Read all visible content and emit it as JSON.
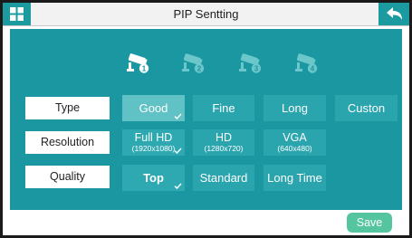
{
  "header": {
    "title": "PIP Sentting",
    "menu_icon": "grid-icon",
    "back_icon": "back-arrow-icon"
  },
  "cameras": [
    {
      "id": "1",
      "icon": "camera-icon",
      "active": true
    },
    {
      "id": "2",
      "icon": "camera-icon",
      "active": false
    },
    {
      "id": "3",
      "icon": "camera-icon",
      "active": false
    },
    {
      "id": "4",
      "icon": "camera-icon",
      "active": false
    }
  ],
  "settings": {
    "type": {
      "label": "Type",
      "options": [
        {
          "label": "Good",
          "selected": true
        },
        {
          "label": "Fine",
          "selected": false
        },
        {
          "label": "Long",
          "selected": false
        },
        {
          "label": "Custon",
          "selected": false
        }
      ]
    },
    "resolution": {
      "label": "Resolution",
      "options": [
        {
          "label": "Full HD",
          "sub": "(1920x1080)",
          "selected": true
        },
        {
          "label": "HD",
          "sub": "(1280x720)",
          "selected": false
        },
        {
          "label": "VGA",
          "sub": "(640x480)",
          "selected": false
        }
      ]
    },
    "quality": {
      "label": "Quality",
      "options": [
        {
          "label": "Top",
          "selected": true
        },
        {
          "label": "Standard",
          "selected": false
        },
        {
          "label": "Long Time",
          "selected": false
        }
      ]
    }
  },
  "footer": {
    "save_label": "Save"
  },
  "colors": {
    "accent": "#1b9aa0",
    "panel": "#1b97a1",
    "option": "#2aa4ad",
    "selected_option": "#60c2c4",
    "save_button": "#55c59f"
  }
}
